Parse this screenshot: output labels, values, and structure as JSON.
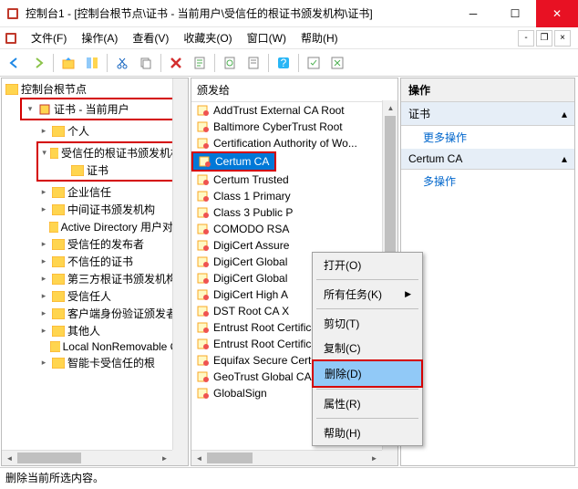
{
  "window": {
    "title": "控制台1 - [控制台根节点\\证书 - 当前用户\\受信任的根证书颁发机构\\证书]"
  },
  "menubar": {
    "file": "文件(F)",
    "action": "操作(A)",
    "view": "查看(V)",
    "favorites": "收藏夹(O)",
    "window": "窗口(W)",
    "help": "帮助(H)"
  },
  "tree": {
    "root": "控制台根节点",
    "cert_user": "证书 - 当前用户",
    "personal": "个人",
    "trusted_root": "受信任的根证书颁发机构",
    "certs": "证书",
    "enterprise": "企业信任",
    "intermediate": "中间证书颁发机构",
    "ad": "Active Directory 用户对象",
    "trusted_pub": "受信任的发布者",
    "untrusted": "不信任的证书",
    "third_party": "第三方根证书颁发机构",
    "trusted_people": "受信任人",
    "client_auth": "客户端身份验证颁发者",
    "others": "其他人",
    "local_nr": "Local NonRemovable Ce",
    "smart_card": "智能卡受信任的根"
  },
  "list": {
    "header": "颁发给",
    "items": [
      "AddTrust External CA Root",
      "Baltimore CyberTrust Root",
      "Certification Authority of Wo...",
      "Certum CA",
      "Certum Trusted",
      "Class 1 Primary",
      "Class 3 Public P",
      "COMODO RSA",
      "DigiCert Assure",
      "DigiCert Global",
      "DigiCert Global",
      "DigiCert High A",
      "DST Root CA X",
      "Entrust Root Certification Au...",
      "Entrust Root Certification Au...",
      "Equifax Secure Certificate Au...",
      "GeoTrust Global CA",
      "GlobalSign"
    ],
    "selected_index": 3
  },
  "context_menu": {
    "open": "打开(O)",
    "all_tasks": "所有任务(K)",
    "cut": "剪切(T)",
    "copy": "复制(C)",
    "delete": "删除(D)",
    "properties": "属性(R)",
    "help": "帮助(H)"
  },
  "actions": {
    "header": "操作",
    "section1": "证书",
    "more1": "更多操作",
    "section2": "Certum CA",
    "more2": "多操作"
  },
  "statusbar": {
    "text": "删除当前所选内容。"
  }
}
